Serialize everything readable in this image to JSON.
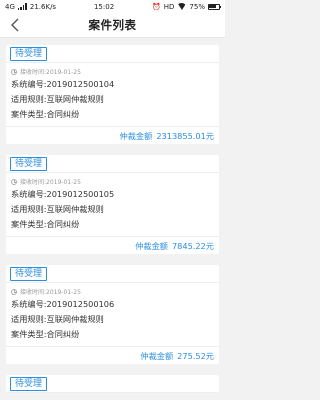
{
  "status_bar": {
    "network": "4G",
    "speed": "21.6K/s",
    "time": "15:02",
    "hd": "HD",
    "battery_text": "75%",
    "battery_level": 0.75
  },
  "header": {
    "title": "案件列表"
  },
  "cases": [
    {
      "status": "待受理",
      "received": "接收时间:2019-01-25",
      "system_no": "系统编号:2019012500104",
      "rule": "适用规则:互联网仲裁规则",
      "case_type": "案件类型:合同纠纷",
      "amount_label": "仲裁金额",
      "amount": "2313855.01元"
    },
    {
      "status": "待受理",
      "received": "接收时间:2019-01-25",
      "system_no": "系统编号:2019012500105",
      "rule": "适用规则:互联网仲裁规则",
      "case_type": "案件类型:合同纠纷",
      "amount_label": "仲裁金额",
      "amount": "7845.22元"
    },
    {
      "status": "待受理",
      "received": "接收时间:2019-01-25",
      "system_no": "系统编号:2019012500106",
      "rule": "适用规则:互联网仲裁规则",
      "case_type": "案件类型:合同纠纷",
      "amount_label": "仲裁金额",
      "amount": "275.52元"
    },
    {
      "status": "待受理"
    }
  ],
  "colors": {
    "accent": "#2b8fe0",
    "background": "#f2f2f2"
  }
}
